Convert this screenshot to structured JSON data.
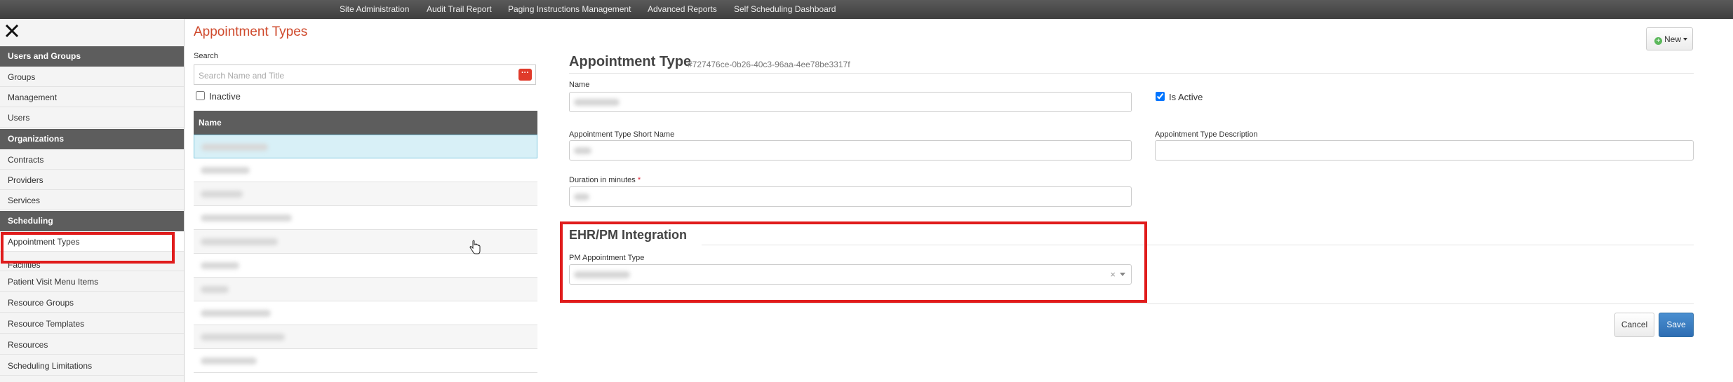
{
  "topnav": {
    "items": [
      "Site Administration",
      "Audit Trail Report",
      "Paging Instructions Management",
      "Advanced Reports",
      "Self Scheduling Dashboard"
    ]
  },
  "sidebar": {
    "sections": [
      {
        "title": "Users and Groups",
        "items": [
          "Groups",
          "Management",
          "Users"
        ]
      },
      {
        "title": "Organizations",
        "items": [
          "Contracts",
          "Providers",
          "Services"
        ]
      },
      {
        "title": "Scheduling",
        "items": [
          "Appointment Types",
          "Facilities",
          "Patient Visit Menu Items",
          "Resource Groups",
          "Resource Templates",
          "Resources",
          "Scheduling Limitations"
        ]
      }
    ]
  },
  "list": {
    "page_title": "Appointment Types",
    "search_label": "Search",
    "search_placeholder": "Search Name and Title",
    "search_button_icon": "more-dots-icon",
    "inactive_label": "Inactive",
    "column_header": "Name"
  },
  "form": {
    "title": "Appointment Type",
    "id": "#727476ce-0b26-40c3-96aa-4ee78be3317f",
    "name_label": "Name",
    "is_active_label": "Is Active",
    "is_active_checked": true,
    "short_name_label": "Appointment Type Short Name",
    "description_label": "Appointment Type Description",
    "duration_label": "Duration in minutes",
    "required_marker": "*",
    "ehr_title": "EHR/PM Integration",
    "pm_type_label": "PM Appointment Type",
    "pm_clear_icon": "×"
  },
  "buttons": {
    "new_label": "New",
    "cancel_label": "Cancel",
    "save_label": "Save"
  },
  "colors": {
    "highlight": "#e01c1c",
    "title_accent": "#cf4a2d",
    "primary": "#2e6db3"
  }
}
